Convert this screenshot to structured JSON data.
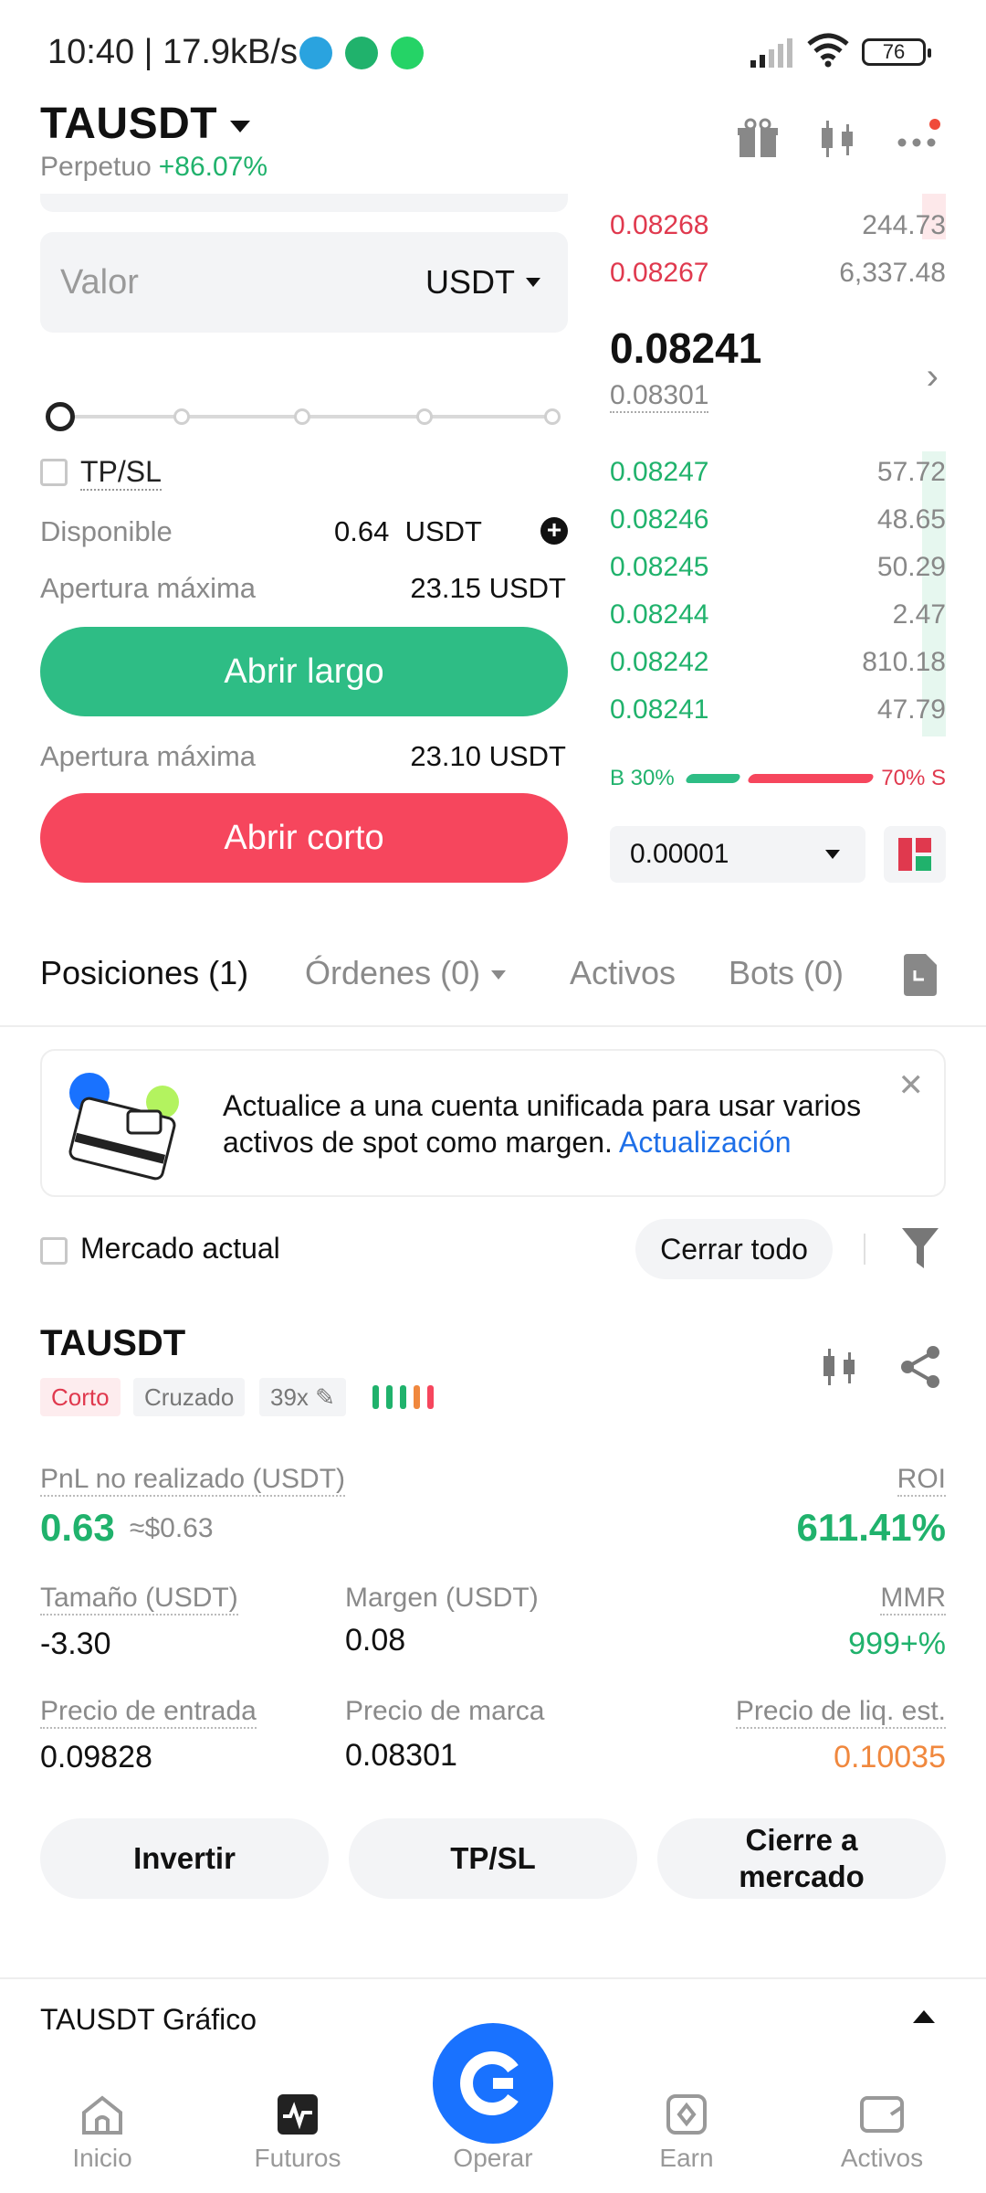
{
  "status_bar": {
    "time_speed": "10:40 | 17.9kB/s",
    "battery": "76"
  },
  "header": {
    "pair": "TAUSDT",
    "contract_type": "Perpetuo",
    "change": "+86.07%"
  },
  "order_form": {
    "value_placeholder": "Valor",
    "value_unit": "USDT",
    "tpsl_label": "TP/SL",
    "available_label": "Disponible",
    "available_value": "0.64",
    "available_unit": "USDT",
    "max_open_label_long": "Apertura máxima",
    "max_open_value_long": "23.15 USDT",
    "open_long": "Abrir largo",
    "max_open_label_short": "Apertura máxima",
    "max_open_value_short": "23.10 USDT",
    "open_short": "Abrir corto"
  },
  "order_book": {
    "asks": [
      {
        "price": "0.08268",
        "qty": "244.73"
      },
      {
        "price": "0.08267",
        "qty": "6,337.48"
      }
    ],
    "last_price": "0.08241",
    "mark_price": "0.08301",
    "bids": [
      {
        "price": "0.08247",
        "qty": "57.72"
      },
      {
        "price": "0.08246",
        "qty": "48.65"
      },
      {
        "price": "0.08245",
        "qty": "50.29"
      },
      {
        "price": "0.08244",
        "qty": "2.47"
      },
      {
        "price": "0.08242",
        "qty": "810.18"
      },
      {
        "price": "0.08241",
        "qty": "47.79"
      }
    ],
    "buy_label": "B 30%",
    "sell_label": "70% S",
    "buy_ratio": 0.3,
    "tick_size": "0.00001"
  },
  "tabs": {
    "positions": "Posiciones (1)",
    "orders": "Órdenes (0)",
    "assets": "Activos",
    "bots": "Bots (0)"
  },
  "banner": {
    "text": "Actualice a una cuenta unificada para usar varios activos de spot como margen.",
    "link": "Actualización"
  },
  "filters": {
    "current_market": "Mercado actual",
    "close_all": "Cerrar todo"
  },
  "position": {
    "symbol": "TAUSDT",
    "side": "Corto",
    "margin_mode": "Cruzado",
    "leverage": "39x",
    "pnl_label": "PnL no realizado (USDT)",
    "pnl_value": "0.63",
    "pnl_usd": "≈$0.63",
    "roi_label": "ROI",
    "roi_value": "611.41%",
    "size_label": "Tamaño (USDT)",
    "size_value": "-3.30",
    "margin_label": "Margen (USDT)",
    "margin_value": "0.08",
    "mmr_label": "MMR",
    "mmr_value": "999+%",
    "entry_label": "Precio de entrada",
    "entry_value": "0.09828",
    "mark_label": "Precio de marca",
    "mark_value": "0.08301",
    "liq_label": "Precio de liq. est.",
    "liq_value": "0.10035",
    "btn_reverse": "Invertir",
    "btn_tpsl": "TP/SL",
    "btn_close_line1": "Cierre a",
    "btn_close_line2": "mercado"
  },
  "chart_section": {
    "label": "TAUSDT Gráfico"
  },
  "bottom_nav": {
    "home": "Inicio",
    "futures": "Futuros",
    "trade": "Operar",
    "earn": "Earn",
    "assets": "Activos"
  },
  "colors": {
    "green": "#2ebd85",
    "red": "#f6465d",
    "blue": "#1972ff",
    "orange": "#f0883e"
  }
}
